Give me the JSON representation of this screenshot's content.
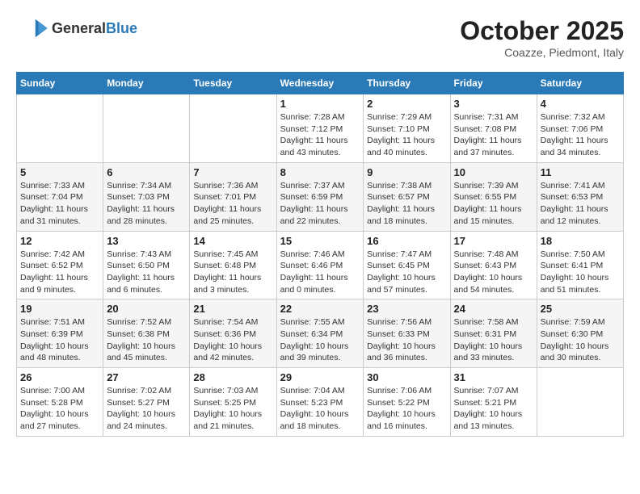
{
  "logo": {
    "general": "General",
    "blue": "Blue"
  },
  "title": "October 2025",
  "location": "Coazze, Piedmont, Italy",
  "headers": [
    "Sunday",
    "Monday",
    "Tuesday",
    "Wednesday",
    "Thursday",
    "Friday",
    "Saturday"
  ],
  "weeks": [
    [
      {
        "day": "",
        "info": ""
      },
      {
        "day": "",
        "info": ""
      },
      {
        "day": "",
        "info": ""
      },
      {
        "day": "1",
        "info": "Sunrise: 7:28 AM\nSunset: 7:12 PM\nDaylight: 11 hours and 43 minutes."
      },
      {
        "day": "2",
        "info": "Sunrise: 7:29 AM\nSunset: 7:10 PM\nDaylight: 11 hours and 40 minutes."
      },
      {
        "day": "3",
        "info": "Sunrise: 7:31 AM\nSunset: 7:08 PM\nDaylight: 11 hours and 37 minutes."
      },
      {
        "day": "4",
        "info": "Sunrise: 7:32 AM\nSunset: 7:06 PM\nDaylight: 11 hours and 34 minutes."
      }
    ],
    [
      {
        "day": "5",
        "info": "Sunrise: 7:33 AM\nSunset: 7:04 PM\nDaylight: 11 hours and 31 minutes."
      },
      {
        "day": "6",
        "info": "Sunrise: 7:34 AM\nSunset: 7:03 PM\nDaylight: 11 hours and 28 minutes."
      },
      {
        "day": "7",
        "info": "Sunrise: 7:36 AM\nSunset: 7:01 PM\nDaylight: 11 hours and 25 minutes."
      },
      {
        "day": "8",
        "info": "Sunrise: 7:37 AM\nSunset: 6:59 PM\nDaylight: 11 hours and 22 minutes."
      },
      {
        "day": "9",
        "info": "Sunrise: 7:38 AM\nSunset: 6:57 PM\nDaylight: 11 hours and 18 minutes."
      },
      {
        "day": "10",
        "info": "Sunrise: 7:39 AM\nSunset: 6:55 PM\nDaylight: 11 hours and 15 minutes."
      },
      {
        "day": "11",
        "info": "Sunrise: 7:41 AM\nSunset: 6:53 PM\nDaylight: 11 hours and 12 minutes."
      }
    ],
    [
      {
        "day": "12",
        "info": "Sunrise: 7:42 AM\nSunset: 6:52 PM\nDaylight: 11 hours and 9 minutes."
      },
      {
        "day": "13",
        "info": "Sunrise: 7:43 AM\nSunset: 6:50 PM\nDaylight: 11 hours and 6 minutes."
      },
      {
        "day": "14",
        "info": "Sunrise: 7:45 AM\nSunset: 6:48 PM\nDaylight: 11 hours and 3 minutes."
      },
      {
        "day": "15",
        "info": "Sunrise: 7:46 AM\nSunset: 6:46 PM\nDaylight: 11 hours and 0 minutes."
      },
      {
        "day": "16",
        "info": "Sunrise: 7:47 AM\nSunset: 6:45 PM\nDaylight: 10 hours and 57 minutes."
      },
      {
        "day": "17",
        "info": "Sunrise: 7:48 AM\nSunset: 6:43 PM\nDaylight: 10 hours and 54 minutes."
      },
      {
        "day": "18",
        "info": "Sunrise: 7:50 AM\nSunset: 6:41 PM\nDaylight: 10 hours and 51 minutes."
      }
    ],
    [
      {
        "day": "19",
        "info": "Sunrise: 7:51 AM\nSunset: 6:39 PM\nDaylight: 10 hours and 48 minutes."
      },
      {
        "day": "20",
        "info": "Sunrise: 7:52 AM\nSunset: 6:38 PM\nDaylight: 10 hours and 45 minutes."
      },
      {
        "day": "21",
        "info": "Sunrise: 7:54 AM\nSunset: 6:36 PM\nDaylight: 10 hours and 42 minutes."
      },
      {
        "day": "22",
        "info": "Sunrise: 7:55 AM\nSunset: 6:34 PM\nDaylight: 10 hours and 39 minutes."
      },
      {
        "day": "23",
        "info": "Sunrise: 7:56 AM\nSunset: 6:33 PM\nDaylight: 10 hours and 36 minutes."
      },
      {
        "day": "24",
        "info": "Sunrise: 7:58 AM\nSunset: 6:31 PM\nDaylight: 10 hours and 33 minutes."
      },
      {
        "day": "25",
        "info": "Sunrise: 7:59 AM\nSunset: 6:30 PM\nDaylight: 10 hours and 30 minutes."
      }
    ],
    [
      {
        "day": "26",
        "info": "Sunrise: 7:00 AM\nSunset: 5:28 PM\nDaylight: 10 hours and 27 minutes."
      },
      {
        "day": "27",
        "info": "Sunrise: 7:02 AM\nSunset: 5:27 PM\nDaylight: 10 hours and 24 minutes."
      },
      {
        "day": "28",
        "info": "Sunrise: 7:03 AM\nSunset: 5:25 PM\nDaylight: 10 hours and 21 minutes."
      },
      {
        "day": "29",
        "info": "Sunrise: 7:04 AM\nSunset: 5:23 PM\nDaylight: 10 hours and 18 minutes."
      },
      {
        "day": "30",
        "info": "Sunrise: 7:06 AM\nSunset: 5:22 PM\nDaylight: 10 hours and 16 minutes."
      },
      {
        "day": "31",
        "info": "Sunrise: 7:07 AM\nSunset: 5:21 PM\nDaylight: 10 hours and 13 minutes."
      },
      {
        "day": "",
        "info": ""
      }
    ]
  ]
}
